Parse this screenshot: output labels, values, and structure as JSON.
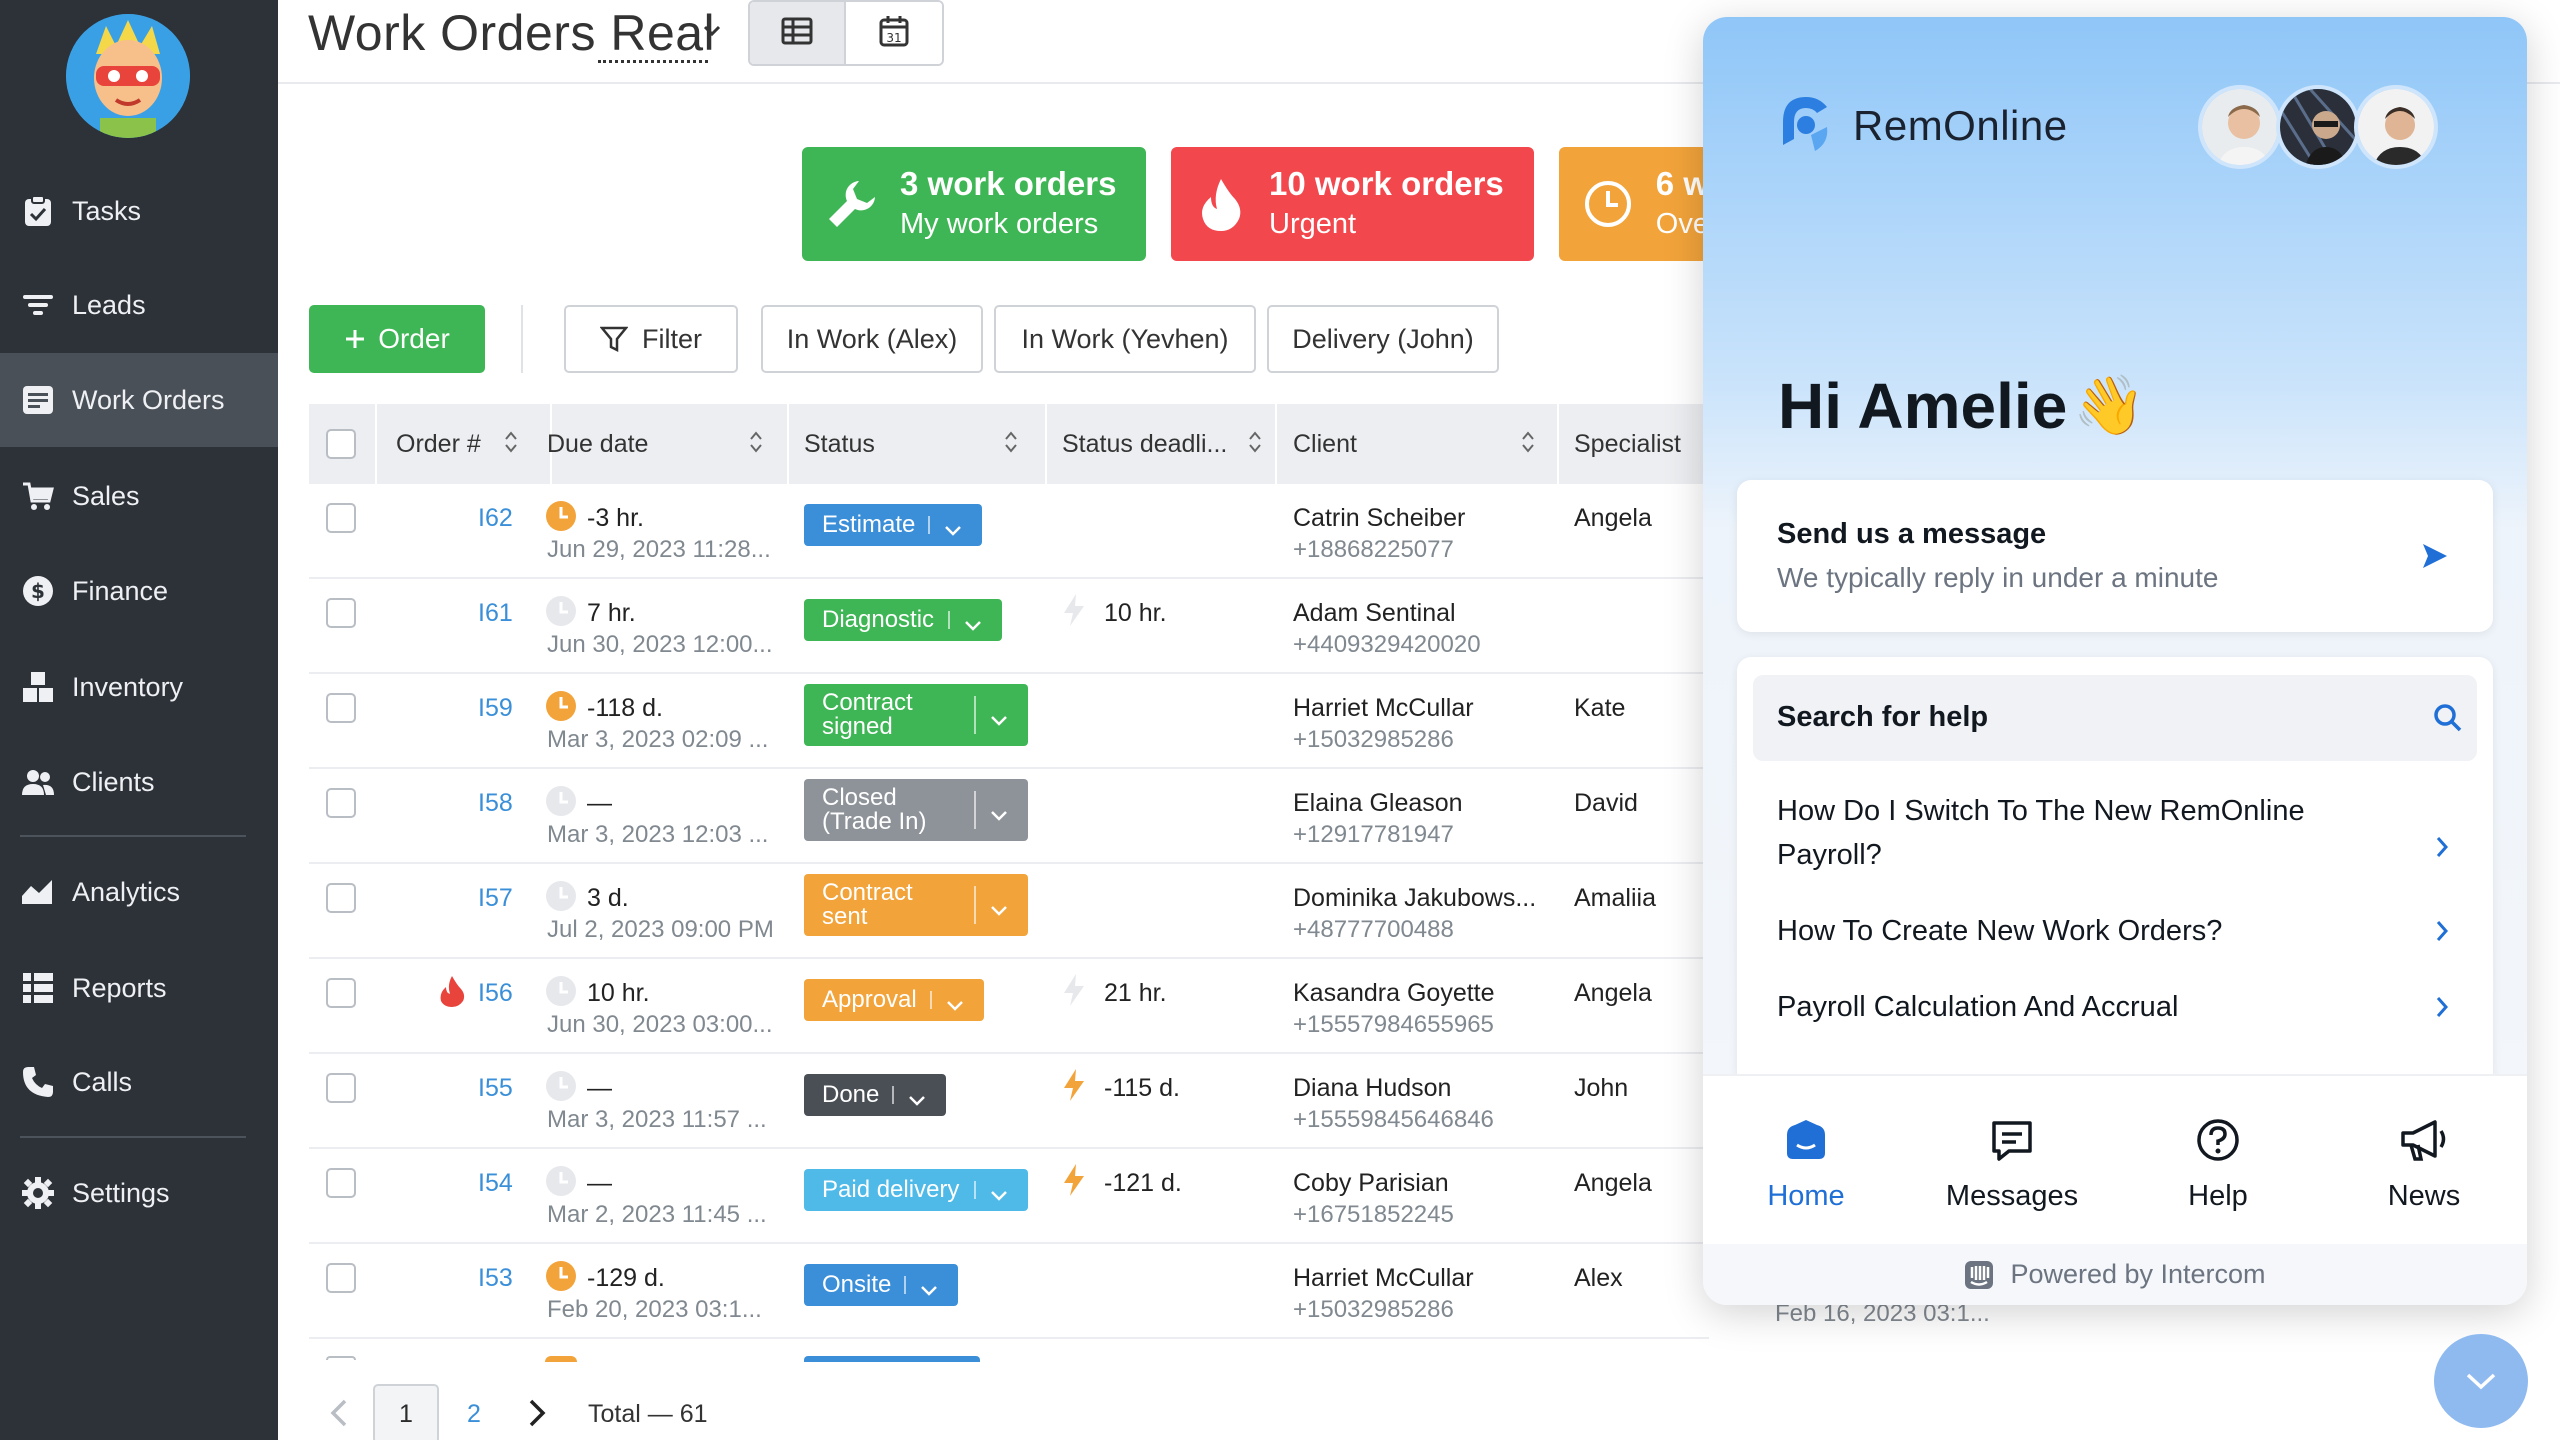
{
  "header": {
    "title": "Work Orders Real",
    "view_table_icon": "table-icon",
    "view_calendar_icon": "calendar-icon",
    "calendar_day": "31"
  },
  "sidebar": {
    "items": [
      {
        "label": "Tasks",
        "icon": "clipboard-icon"
      },
      {
        "label": "Leads",
        "icon": "funnel-icon"
      },
      {
        "label": "Work Orders",
        "icon": "work-order-icon"
      },
      {
        "label": "Sales",
        "icon": "cart-icon"
      },
      {
        "label": "Finance",
        "icon": "dollar-icon"
      },
      {
        "label": "Inventory",
        "icon": "boxes-icon"
      },
      {
        "label": "Clients",
        "icon": "users-icon"
      },
      {
        "label": "Analytics",
        "icon": "chart-icon"
      },
      {
        "label": "Reports",
        "icon": "reports-icon"
      },
      {
        "label": "Calls",
        "icon": "phone-icon"
      },
      {
        "label": "Settings",
        "icon": "gear-icon"
      }
    ]
  },
  "kpis": [
    {
      "line1": "3 work orders",
      "line2": "My work orders",
      "color": "#3fb655",
      "icon": "wrench-icon"
    },
    {
      "line1": "10 work orders",
      "line2": "Urgent",
      "color": "#f2474d",
      "icon": "flame-icon"
    },
    {
      "line1": "6 w",
      "line2": "Ove",
      "color": "#f2a33a",
      "icon": "clock-icon"
    }
  ],
  "toolbar": {
    "order_label": "Order",
    "filter_label": "Filter",
    "preset1": "In Work (Alex)",
    "preset2": "In Work (Yevhen)",
    "preset3": "Delivery (John)"
  },
  "table": {
    "headers": [
      "Order #",
      "Due date",
      "Status",
      "Status deadli...",
      "Client",
      "Specialist"
    ],
    "rows": [
      {
        "order": "I62",
        "due_main": "-3 hr.",
        "due_sub": "Jun 29, 2023 11:28...",
        "clock": "orange",
        "status": [
          "Estimate"
        ],
        "status_color": "#3a8fd8",
        "deadline": "",
        "bolt": "",
        "client": "Catrin Scheiber",
        "phone": "+18868225077",
        "specialist": "Angela",
        "urgent": false
      },
      {
        "order": "I61",
        "due_main": "7 hr.",
        "due_sub": "Jun 30, 2023 12:00...",
        "clock": "grey",
        "status": [
          "Diagnostic"
        ],
        "status_color": "#3fb655",
        "deadline": "10 hr.",
        "bolt": "grey",
        "client": "Adam Sentinal",
        "phone": "+4409329420020",
        "specialist": "",
        "urgent": false
      },
      {
        "order": "I59",
        "due_main": "-118 d.",
        "due_sub": "Mar 3, 2023 02:09 ...",
        "clock": "orange",
        "status": [
          "Contract",
          "signed"
        ],
        "status_color": "#3fb655",
        "deadline": "",
        "bolt": "",
        "client": "Harriet McCullar",
        "phone": "+15032985286",
        "specialist": "Kate",
        "urgent": false
      },
      {
        "order": "I58",
        "due_main": "—",
        "due_sub": "Mar 3, 2023 12:03 ...",
        "clock": "grey",
        "status": [
          "Closed",
          "(Trade In)"
        ],
        "status_color": "#8e9399",
        "deadline": "",
        "bolt": "",
        "client": "Elaina Gleason",
        "phone": "+12917781947",
        "specialist": "David",
        "urgent": false
      },
      {
        "order": "I57",
        "due_main": "3 d.",
        "due_sub": "Jul 2, 2023 09:00 PM",
        "clock": "grey",
        "status": [
          "Contract",
          "sent"
        ],
        "status_color": "#f2a33a",
        "deadline": "",
        "bolt": "",
        "client": "Dominika Jakubows...",
        "phone": "+48777700488",
        "specialist": "Amaliia",
        "urgent": false
      },
      {
        "order": "I56",
        "due_main": "10 hr.",
        "due_sub": "Jun 30, 2023 03:00...",
        "clock": "grey",
        "status": [
          "Approval"
        ],
        "status_color": "#f2a33a",
        "deadline": "21 hr.",
        "bolt": "grey",
        "client": "Kasandra Goyette",
        "phone": "+15557984655965",
        "specialist": "Angela",
        "urgent": true
      },
      {
        "order": "I55",
        "due_main": "—",
        "due_sub": "Mar 3, 2023 11:57 ...",
        "clock": "grey",
        "status": [
          "Done"
        ],
        "status_color": "#4a4f56",
        "deadline": "-115 d.",
        "bolt": "orange",
        "client": "Diana Hudson",
        "phone": "+15559845646846",
        "specialist": "John",
        "urgent": false
      },
      {
        "order": "I54",
        "due_main": "—",
        "due_sub": "Mar 2, 2023 11:45 ...",
        "clock": "grey",
        "status": [
          "Paid delivery"
        ],
        "status_color": "#4fb9e8",
        "deadline": "-121 d.",
        "bolt": "orange",
        "client": "Coby Parisian",
        "phone": "+16751852245",
        "specialist": "Angela",
        "urgent": false
      },
      {
        "order": "I53",
        "due_main": "-129 d.",
        "due_sub": "Feb 20, 2023 03:1...",
        "clock": "orange",
        "status": [
          "Onsite"
        ],
        "status_color": "#3a8fd8",
        "deadline": "",
        "bolt": "",
        "client": "Harriet McCullar",
        "phone": "+15032985286",
        "specialist": "Alex",
        "urgent": false
      }
    ],
    "behind_panel_date": "Feb 16, 2023 03:1..."
  },
  "pagination": {
    "current": "1",
    "next_page": "2",
    "total": "Total — 61"
  },
  "intercom": {
    "brand": "RemOnline",
    "greeting": "Hi Amelie",
    "wave_emoji": "👋",
    "message_title": "Send us a message",
    "message_sub": "We typically reply in under a minute",
    "search_label": "Search for help",
    "articles": [
      "How Do I Switch To The New RemOnline Payroll?",
      "How To Create New Work Orders?",
      "Payroll Calculation And Accrual"
    ],
    "tabs": [
      {
        "label": "Home",
        "icon": "home-icon"
      },
      {
        "label": "Messages",
        "icon": "messages-icon"
      },
      {
        "label": "Help",
        "icon": "help-icon"
      },
      {
        "label": "News",
        "icon": "megaphone-icon"
      }
    ],
    "footer": "Powered by Intercom",
    "accent": "#1f6fd6"
  }
}
